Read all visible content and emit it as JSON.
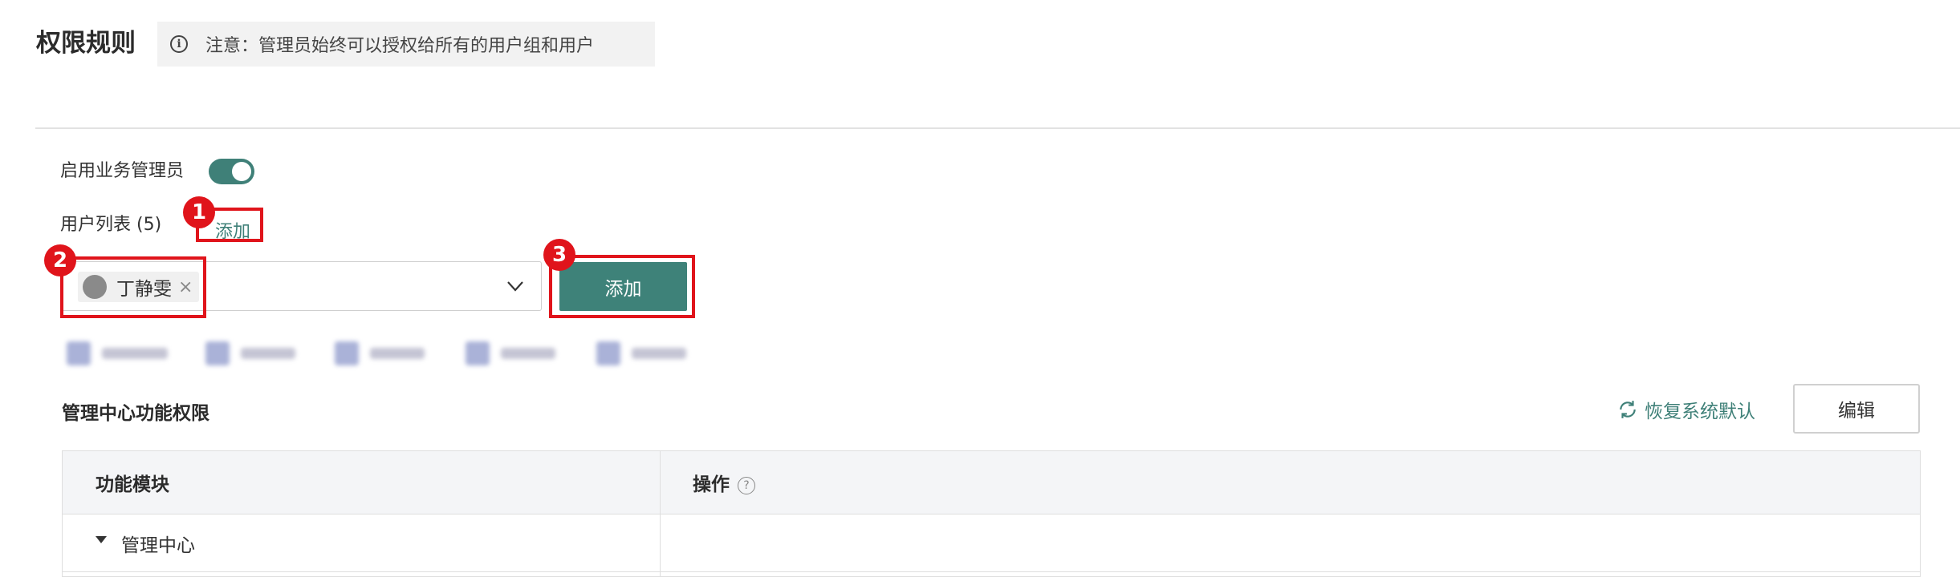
{
  "header": {
    "title": "权限规则",
    "notice_icon": "info-icon",
    "notice_text": "注意：管理员始终可以授权给所有的用户组和用户"
  },
  "settings": {
    "business_admin_label": "启用业务管理员",
    "business_admin_enabled": true,
    "user_list_label": "用户列表 (5)",
    "add_link_label": "添加"
  },
  "selector": {
    "selected_user": "丁静雯",
    "remove_glyph": "×",
    "add_button_label": "添加"
  },
  "annotations": [
    "1",
    "2",
    "3"
  ],
  "section": {
    "title": "管理中心功能权限",
    "restore_label": "恢复系统默认",
    "edit_label": "编辑"
  },
  "table": {
    "columns": [
      "功能模块",
      "操作"
    ],
    "help_glyph": "?",
    "rows": [
      {
        "label": "管理中心"
      }
    ]
  },
  "colors": {
    "accent": "#3f8078",
    "annotation": "#e0141b"
  }
}
